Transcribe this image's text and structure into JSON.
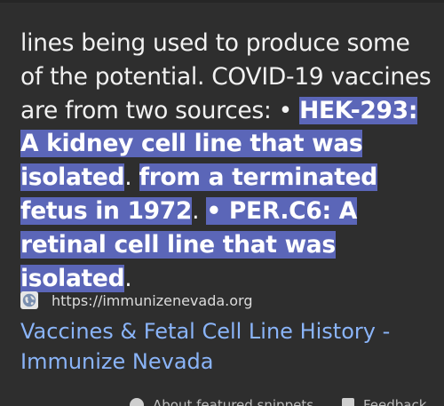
{
  "snippet": {
    "plain_1": "lines being used to produce some of the potential. COVID-19 vaccines are from two sources: • ",
    "hl_1": "HEK-293: A kidney cell line that was isolated",
    "plain_2": ". ",
    "hl_2": "from a terminated fetus in 1972",
    "plain_3": ". ",
    "hl_3": "• PER.C6: A retinal cell line that was isolated",
    "plain_4": "."
  },
  "source": {
    "icon": "globe-icon",
    "url": "https://immunizenevada.org"
  },
  "result": {
    "title": "Vaccines & Fetal Cell Line History - Immunize Nevada"
  },
  "footer": {
    "about_label": "About featured snippets",
    "about_icon": "help-icon",
    "feedback_label": "Feedback",
    "feedback_icon": "feedback-icon"
  },
  "colors": {
    "background": "#2e2e2e",
    "highlight": "#5b66b8",
    "link": "#8ab4f8"
  }
}
